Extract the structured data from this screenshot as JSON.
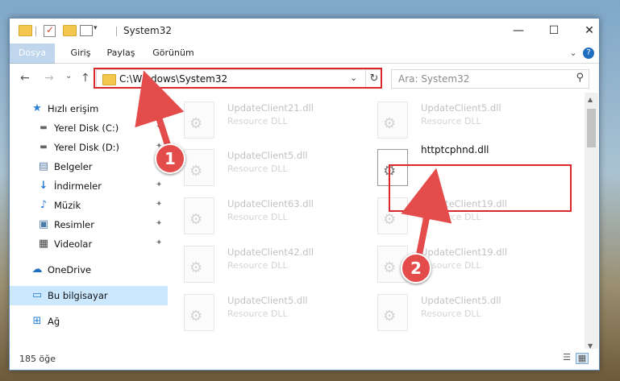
{
  "window": {
    "title": "System32",
    "controls": {
      "minimize": "—",
      "maximize": "☐",
      "close": "✕"
    }
  },
  "ribbon": {
    "tabs": [
      "Dosya",
      "Giriş",
      "Paylaş",
      "Görünüm"
    ],
    "help_icon": "?"
  },
  "nav": {
    "back": "←",
    "forward": "→",
    "recent": "⌄",
    "up": "↑",
    "address": "C:\\Windows\\System32",
    "refresh": "↻",
    "search_placeholder": "Ara: System32",
    "search_icon": "⚲"
  },
  "sidebar": {
    "items": [
      {
        "label": "Hızlı erişim",
        "icon": "star-icon",
        "glyph": "★",
        "pinned": false
      },
      {
        "label": "Yerel Disk (C:)",
        "icon": "drive-icon",
        "glyph": "▬",
        "pinned": true
      },
      {
        "label": "Yerel Disk (D:)",
        "icon": "drive-icon",
        "glyph": "▬",
        "pinned": true
      },
      {
        "label": "Belgeler",
        "icon": "documents-icon",
        "glyph": "▤",
        "pinned": true
      },
      {
        "label": "İndirmeler",
        "icon": "download-icon",
        "glyph": "↓",
        "pinned": true
      },
      {
        "label": "Müzik",
        "icon": "music-icon",
        "glyph": "♪",
        "pinned": true
      },
      {
        "label": "Resimler",
        "icon": "pictures-icon",
        "glyph": "▣",
        "pinned": true
      },
      {
        "label": "Videolar",
        "icon": "video-icon",
        "glyph": "▦",
        "pinned": true
      },
      {
        "label": "OneDrive",
        "icon": "cloud-icon",
        "glyph": "☁",
        "pinned": false
      },
      {
        "label": "Bu bilgisayar",
        "icon": "computer-icon",
        "glyph": "▭",
        "pinned": false
      },
      {
        "label": "Ağ",
        "icon": "network-icon",
        "glyph": "⊞",
        "pinned": false
      }
    ],
    "pin_glyph": "📌"
  },
  "files": [
    {
      "name": "UpdateClient21.dll",
      "type": "Resource DLL"
    },
    {
      "name": "UpdateClient5.dll",
      "type": "Resource DLL"
    },
    {
      "name": "UpdateClient5.dll",
      "type": "Resource DLL"
    },
    {
      "name": "httptcphnd.dll",
      "type": ""
    },
    {
      "name": "UpdateClient63.dll",
      "type": "Resource DLL"
    },
    {
      "name": "UpdateClient19.dll",
      "type": "Resource DLL"
    },
    {
      "name": "UpdateClient42.dll",
      "type": "Resource DLL"
    },
    {
      "name": "UpdateClient19.dll",
      "type": "Resource DLL"
    },
    {
      "name": "UpdateClient5.dll",
      "type": "Resource DLL"
    },
    {
      "name": "UpdateClient5.dll",
      "type": "Resource DLL"
    }
  ],
  "status": {
    "item_count": "185 öğe",
    "view_details": "☰",
    "view_icons": "▦"
  },
  "annotations": [
    "1",
    "2"
  ],
  "colors": {
    "accent": "#1e6fbf",
    "highlight": "#d9292f",
    "selected": "#cce8ff"
  }
}
